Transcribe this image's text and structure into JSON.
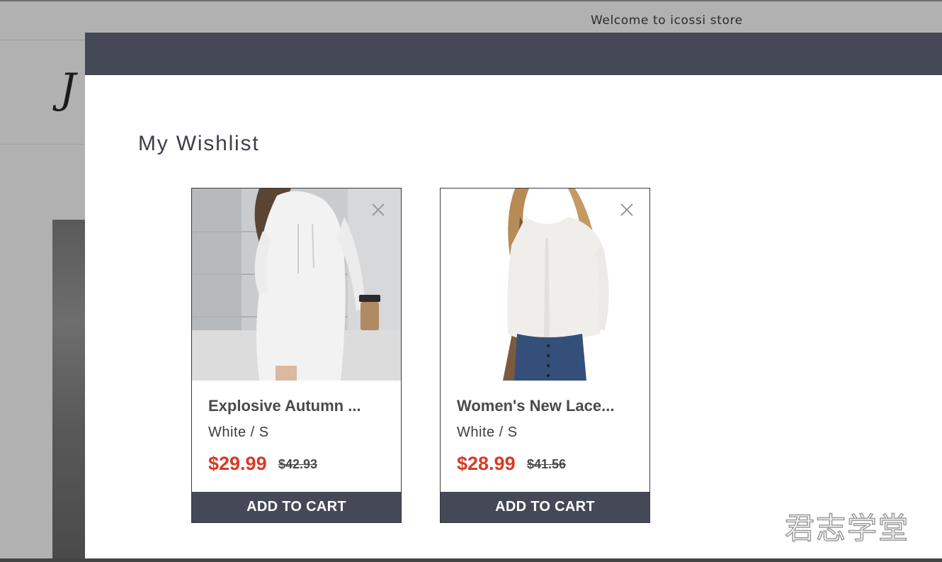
{
  "announcement": {
    "text": "Welcome to icossi store"
  },
  "store": {
    "logo_glyph": "J"
  },
  "wishlist": {
    "title": "My Wishlist",
    "items": [
      {
        "title": "Explosive Autumn and Winter Hooded Long Sleeve Dress",
        "title_display": "Explosive Autumn ...",
        "variant": "White / S",
        "price": "$29.99",
        "compare_price": "$42.93",
        "add_to_cart_label": "ADD TO CART"
      },
      {
        "title": "Women's New Lace V-Neck Long Sleeve Top",
        "title_display": "Women's New Lace...",
        "variant": "White / S",
        "price": "$28.99",
        "compare_price": "$41.56",
        "add_to_cart_label": "ADD TO CART"
      }
    ]
  },
  "watermark": {
    "text": "君志学堂"
  },
  "colors": {
    "accent": "#454857",
    "price": "#d63b25",
    "overlay": "#b1b1b1"
  }
}
